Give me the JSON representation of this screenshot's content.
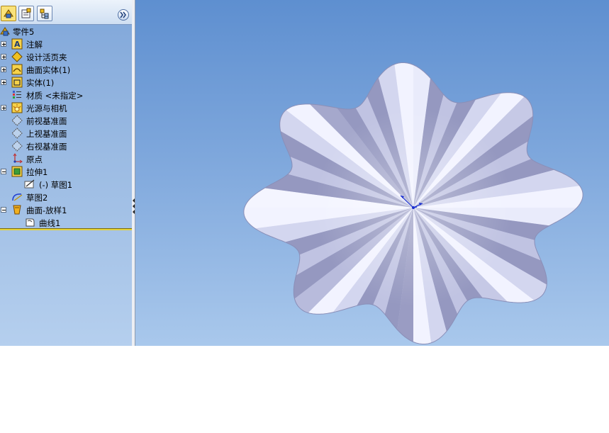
{
  "feature_tree": {
    "tabs": [
      {
        "icon": "feature-manager-icon",
        "active": true
      },
      {
        "icon": "property-manager-icon",
        "active": false
      },
      {
        "icon": "configuration-manager-icon",
        "active": false
      }
    ],
    "expand_icon": "double-chevron-right-icon",
    "items": [
      {
        "label": "零件5",
        "icon": "part-icon",
        "expander": "none"
      },
      {
        "label": "注解",
        "icon": "annotations-icon",
        "expander": "plus"
      },
      {
        "label": "设计活页夹",
        "icon": "design-binder-icon",
        "expander": "plus"
      },
      {
        "label": "曲面实体(1)",
        "icon": "surface-bodies-icon",
        "expander": "plus"
      },
      {
        "label": "实体(1)",
        "icon": "solid-bodies-icon",
        "expander": "plus"
      },
      {
        "label": "材质 <未指定>",
        "icon": "material-icon",
        "expander": "none"
      },
      {
        "label": "光源与相机",
        "icon": "lights-cameras-icon",
        "expander": "plus"
      },
      {
        "label": "前视基准面",
        "icon": "plane-icon",
        "expander": "none"
      },
      {
        "label": "上视基准面",
        "icon": "plane-icon",
        "expander": "none"
      },
      {
        "label": "右视基准面",
        "icon": "plane-icon",
        "expander": "none"
      },
      {
        "label": "原点",
        "icon": "origin-icon",
        "expander": "none"
      },
      {
        "label": "拉伸1",
        "icon": "extrude-icon",
        "expander": "minus"
      },
      {
        "label": "(-) 草图1",
        "icon": "sketch-icon",
        "expander": "none"
      },
      {
        "label": "草图2",
        "icon": "sketch-icon",
        "expander": "none"
      },
      {
        "label": "曲面-放样1",
        "icon": "surface-loft-icon",
        "expander": "minus"
      },
      {
        "label": "曲线1",
        "icon": "curve-icon",
        "expander": "none"
      }
    ]
  },
  "viewport": {
    "background_top": "#5e8fd0",
    "background_bottom": "#a9c8ec",
    "model": "wavy-lofted-surface",
    "surface_color": "#c9cde8",
    "triad_color": "#1a2fd1"
  }
}
